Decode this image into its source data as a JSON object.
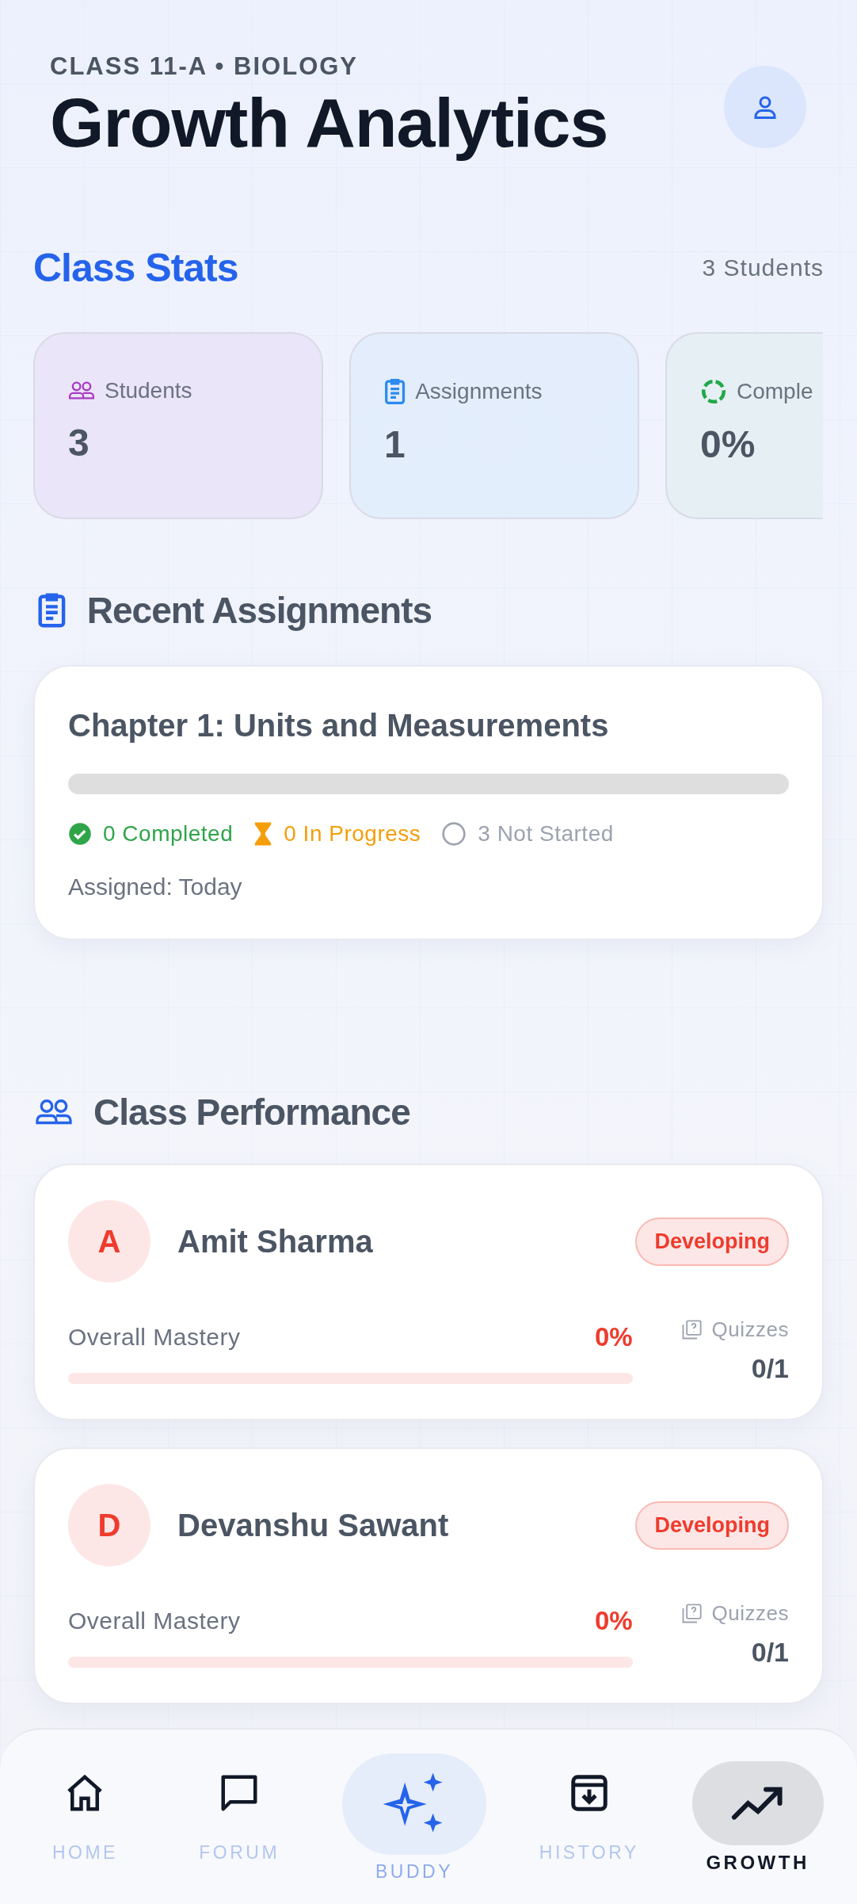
{
  "header": {
    "subtitle": "CLASS 11-A • BIOLOGY",
    "title": "Growth Analytics"
  },
  "class_stats": {
    "title": "Class Stats",
    "count": "3 Students",
    "cards": [
      {
        "kind": "students",
        "label": "Students",
        "value": "3"
      },
      {
        "kind": "assignments",
        "label": "Assignments",
        "value": "1"
      },
      {
        "kind": "completion",
        "label": "Comple",
        "value": "0%"
      }
    ]
  },
  "recent_assignments": {
    "title": "Recent Assignments",
    "items": [
      {
        "title": "Chapter 1: Units and Measurements",
        "level": 0,
        "assigned": "Assigned: Today",
        "statuses": [
          {
            "kind": "completed",
            "text": "0 Completed"
          },
          {
            "kind": "in_progress",
            "text": "0 In Progress"
          },
          {
            "kind": "not_started",
            "text": "3 Not Started"
          }
        ]
      }
    ]
  },
  "class_performance": {
    "title": "Class Performance",
    "students": [
      {
        "initial": "A",
        "name": "Amit Sharma",
        "badge": "Developing",
        "mastery_label": "Overall Mastery",
        "mastery": "0%",
        "level": 0,
        "quizzes_label": "Quizzes",
        "quizzes": "0/1"
      },
      {
        "initial": "D",
        "name": "Devanshu Sawant",
        "badge": "Developing",
        "mastery_label": "Overall Mastery",
        "mastery": "0%",
        "level": 0,
        "quizzes_label": "Quizzes",
        "quizzes": "0/1"
      }
    ]
  },
  "nav": [
    {
      "label": "HOME",
      "kind": "regular",
      "selected": false
    },
    {
      "label": "FORUM",
      "kind": "regular",
      "selected": false
    },
    {
      "label": "BUDDY",
      "kind": "featured",
      "selected": false
    },
    {
      "label": "HISTORY",
      "kind": "regular",
      "selected": false
    },
    {
      "label": "GROWTH",
      "kind": "regular",
      "selected": true
    }
  ]
}
